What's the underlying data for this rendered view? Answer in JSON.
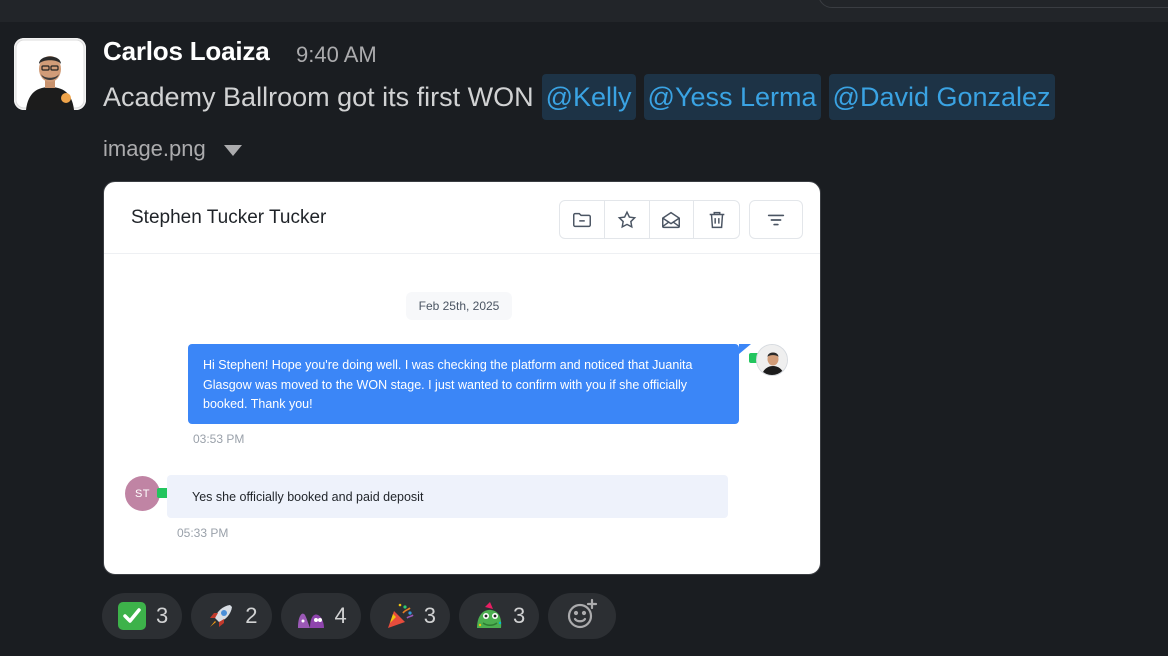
{
  "message": {
    "sender": "Carlos Loaiza",
    "time": "9:40 AM",
    "text": "Academy Ballroom got its first WON",
    "mentions": [
      "@Kelly",
      "@Yess Lerma",
      "@David Gonzalez"
    ],
    "file_name": "image.png"
  },
  "attachment": {
    "contact_name": "Stephen Tucker Tucker",
    "toolbar_icons": [
      "folder-icon",
      "star-icon",
      "envelope-open-icon",
      "trash-icon",
      "filter-icon"
    ],
    "date_chip": "Feb 25th, 2025",
    "outgoing": {
      "text": "Hi Stephen! Hope you're doing well. I was checking the platform and noticed that Juanita Glasgow was moved to the WON stage. I just wanted to confirm with you if she officially booked. Thank you!",
      "time": "03:53 PM"
    },
    "incoming": {
      "initials": "ST",
      "text": "Yes she officially booked and paid deposit",
      "time": "05:33 PM"
    },
    "colors": {
      "outgoing_bubble": "#3b86f7",
      "incoming_bubble": "#eef2fb",
      "sms_badge": "#22c55e"
    }
  },
  "reactions": [
    {
      "icon": "white-check-mark-icon",
      "count": "3"
    },
    {
      "icon": "rocket-icon",
      "count": "2"
    },
    {
      "icon": "purple-blob-icon",
      "count": "4"
    },
    {
      "icon": "party-popper-icon",
      "count": "3"
    },
    {
      "icon": "party-frog-icon",
      "count": "3"
    }
  ],
  "colors": {
    "background": "#1a1d21",
    "mention_bg": "#1d3346",
    "mention_text": "#3aa3e3"
  }
}
